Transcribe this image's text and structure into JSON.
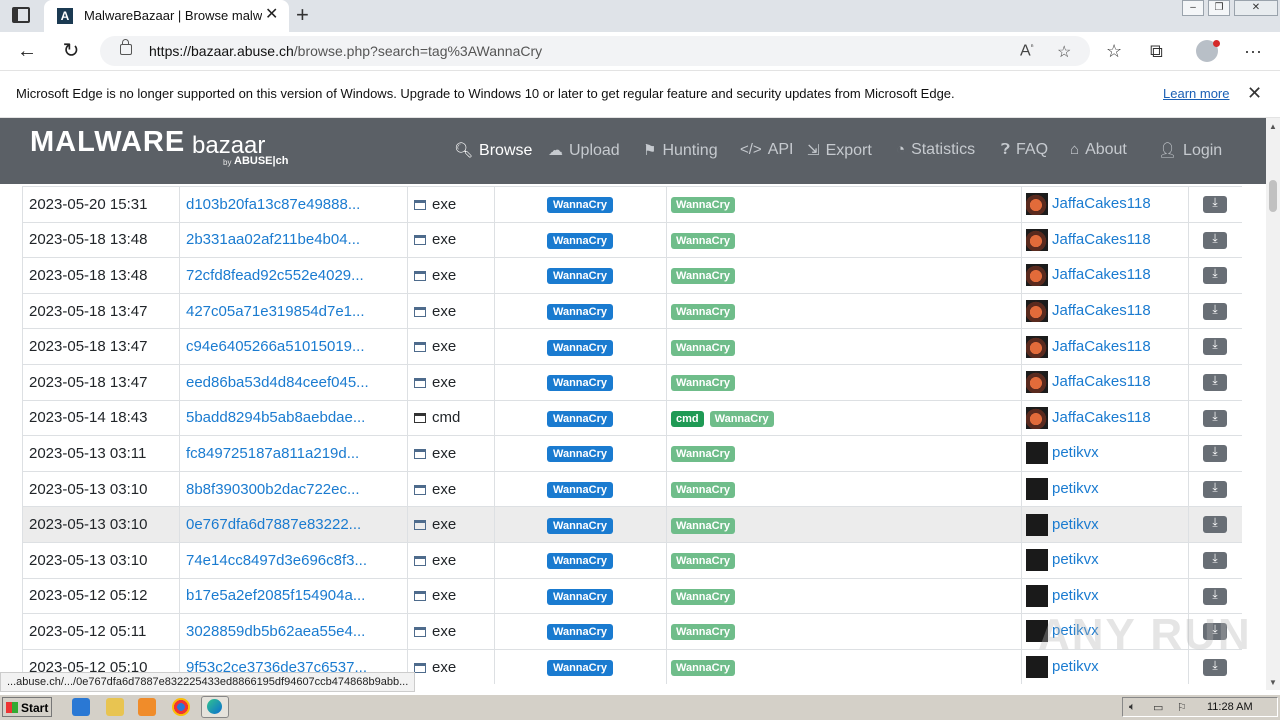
{
  "browser": {
    "tab_title": "MalwareBazaar | Browse malware",
    "favicon": "A",
    "url_domain": "https://bazaar.abuse.ch",
    "url_path": "/browse.php?search=tag%3AWannaCry",
    "info_text": "Microsoft Edge is no longer supported on this version of Windows. Upgrade to Windows 10 or later to get regular feature and security updates from Microsoft Edge.",
    "info_link": "Learn more",
    "status_url": "...abuse.ch/.../0e767dfa6d7887e832225433ed8866195df94607ccb474868b9abb..."
  },
  "site": {
    "logo_main": "MALWARE",
    "logo_sub": "bazaar",
    "logo_by": "by",
    "logo_abuse": "ABUSE|ch",
    "nav": [
      {
        "label": "Browse",
        "icon": "search-icon"
      },
      {
        "label": "Upload",
        "icon": "cloud-upload-icon"
      },
      {
        "label": "Hunting",
        "icon": "hunting-icon"
      },
      {
        "label": "API",
        "icon": "code-icon"
      },
      {
        "label": "Export",
        "icon": "export-icon"
      },
      {
        "label": "Statistics",
        "icon": "pie-chart-icon"
      },
      {
        "label": "FAQ",
        "icon": "question-icon"
      },
      {
        "label": "About",
        "icon": "building-icon"
      },
      {
        "label": "Login",
        "icon": "user-icon"
      }
    ]
  },
  "rows": [
    {
      "date": "2023-05-20 15:31",
      "hash": "d103b20fa13c87e49888...",
      "type": "exe",
      "signature": "WannaCry",
      "tags": [
        "WannaCry"
      ],
      "reporter": "JaffaCakes118"
    },
    {
      "date": "2023-05-18 13:48",
      "hash": "2b331aa02af211be4b04...",
      "type": "exe",
      "signature": "WannaCry",
      "tags": [
        "WannaCry"
      ],
      "reporter": "JaffaCakes118"
    },
    {
      "date": "2023-05-18 13:48",
      "hash": "72cfd8fead92c552e4029...",
      "type": "exe",
      "signature": "WannaCry",
      "tags": [
        "WannaCry"
      ],
      "reporter": "JaffaCakes118"
    },
    {
      "date": "2023-05-18 13:47",
      "hash": "427c05a71e319854d7e1...",
      "type": "exe",
      "signature": "WannaCry",
      "tags": [
        "WannaCry"
      ],
      "reporter": "JaffaCakes118"
    },
    {
      "date": "2023-05-18 13:47",
      "hash": "c94e6405266a51015019...",
      "type": "exe",
      "signature": "WannaCry",
      "tags": [
        "WannaCry"
      ],
      "reporter": "JaffaCakes118"
    },
    {
      "date": "2023-05-18 13:47",
      "hash": "eed86ba53d4d84ceef045...",
      "type": "exe",
      "signature": "WannaCry",
      "tags": [
        "WannaCry"
      ],
      "reporter": "JaffaCakes118"
    },
    {
      "date": "2023-05-14 18:43",
      "hash": "5badd8294b5ab8aebdae...",
      "type": "cmd",
      "signature": "WannaCry",
      "tags": [
        "cmd",
        "WannaCry"
      ],
      "reporter": "JaffaCakes118"
    },
    {
      "date": "2023-05-13 03:11",
      "hash": "fc849725187a811a219d...",
      "type": "exe",
      "signature": "WannaCry",
      "tags": [
        "WannaCry"
      ],
      "reporter": "petikvx"
    },
    {
      "date": "2023-05-13 03:10",
      "hash": "8b8f390300b2dac722ec...",
      "type": "exe",
      "signature": "WannaCry",
      "tags": [
        "WannaCry"
      ],
      "reporter": "petikvx"
    },
    {
      "date": "2023-05-13 03:10",
      "hash": "0e767dfa6d7887e83222...",
      "type": "exe",
      "signature": "WannaCry",
      "tags": [
        "WannaCry"
      ],
      "reporter": "petikvx",
      "hover": true
    },
    {
      "date": "2023-05-13 03:10",
      "hash": "74e14cc8497d3e696c8f3...",
      "type": "exe",
      "signature": "WannaCry",
      "tags": [
        "WannaCry"
      ],
      "reporter": "petikvx"
    },
    {
      "date": "2023-05-12 05:12",
      "hash": "b17e5a2ef2085f154904a...",
      "type": "exe",
      "signature": "WannaCry",
      "tags": [
        "WannaCry"
      ],
      "reporter": "petikvx"
    },
    {
      "date": "2023-05-12 05:11",
      "hash": "3028859db5b62aea55e4...",
      "type": "exe",
      "signature": "WannaCry",
      "tags": [
        "WannaCry"
      ],
      "reporter": "petikvx"
    },
    {
      "date": "2023-05-12 05:10",
      "hash": "9f53c2ce3736de37c6537...",
      "type": "exe",
      "signature": "WannaCry",
      "tags": [
        "WannaCry"
      ],
      "reporter": "petikvx"
    }
  ],
  "watermark": "ANY RUN",
  "taskbar": {
    "start_label": "Start",
    "clock": "11:28 AM"
  }
}
